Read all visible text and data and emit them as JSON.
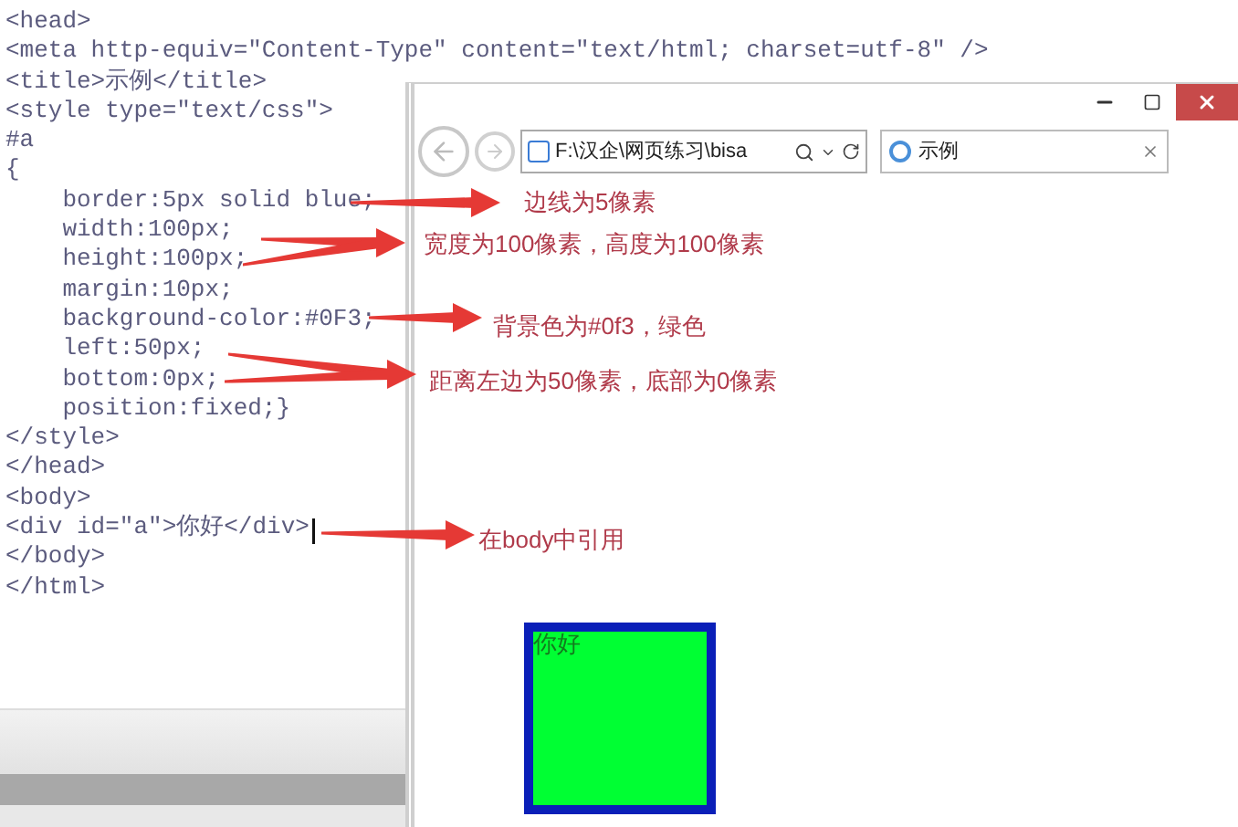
{
  "editor": {
    "lines": [
      "<head>",
      "<meta http-equiv=\"Content-Type\" content=\"text/html; charset=utf-8\" />",
      "<title>示例</title>",
      "<style type=\"text/css\">",
      "#a",
      "{",
      "    border:5px solid blue;",
      "    width:100px;",
      "    height:100px;",
      "    margin:10px;",
      "    background-color:#0F3;",
      "    left:50px;",
      "    bottom:0px;",
      "    position:fixed;}",
      "</style>",
      "</head>",
      "<body>",
      "<div id=\"a\">你好</div>",
      "</body>",
      "</html>"
    ]
  },
  "browser": {
    "address": "F:\\汉企\\网页练习\\bisa",
    "tab": {
      "title": "示例"
    },
    "page": {
      "box_text": "你好"
    }
  },
  "annotations": [
    {
      "text": "边线为5像素"
    },
    {
      "text": "宽度为100像素，高度为100像素"
    },
    {
      "text": "背景色为#0f3，绿色"
    },
    {
      "text": "距离左边为50像素，底部为0像素"
    },
    {
      "text": "在body中引用"
    }
  ]
}
